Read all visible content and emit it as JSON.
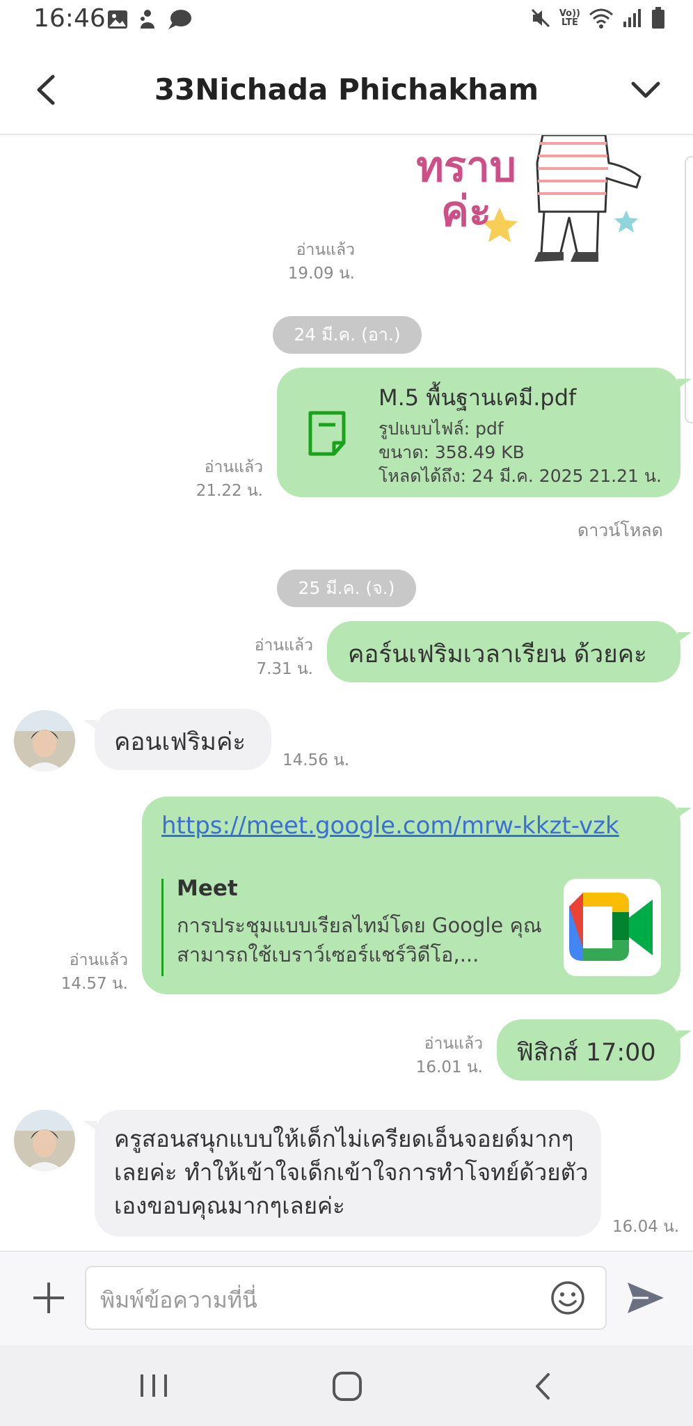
{
  "status_bar": {
    "time": "16:46",
    "left_icons": [
      "image-icon",
      "gesture-icon",
      "chat-bubble-icon"
    ],
    "volte_label": "Vo))\nLTE",
    "right_icons": [
      "mute-icon",
      "volte-icon",
      "wifi-icon",
      "signal-icon",
      "battery-icon"
    ]
  },
  "header": {
    "title": "33Nichada Phichakham"
  },
  "chat": {
    "sticker_read": {
      "status": "อ่านแล้ว",
      "time": "19.09 น."
    },
    "sticker_text": "ทราบ\nค่ะ",
    "date_1": "24 มี.ค. (อา.)",
    "file": {
      "name": "M.5 พื้นฐานเคมี.pdf",
      "type_line": "รูปแบบไฟล์: pdf",
      "size_line": "ขนาด: 358.49 KB",
      "expiry_line": "โหลดได้ถึง: 24 มี.ค. 2025 21.21 น.",
      "read": "อ่านแล้ว",
      "time": "21.22 น.",
      "download_label": "ดาวน์โหลด"
    },
    "date_2": "25 มี.ค. (จ.)",
    "msg_out_1": {
      "text": "คอร์นเฟริมเวลาเรียน ด้วยคะ",
      "read": "อ่านแล้ว",
      "time": "7.31 น."
    },
    "msg_in_1": {
      "text": "คอนเฟริมค่ะ",
      "time": "14.56 น."
    },
    "link_msg": {
      "url": "https://meet.google.com/mrw-kkzt-vzk",
      "preview_title": "Meet",
      "preview_desc": "การประชุมแบบเรียลไทม์โดย Google คุณสามารถใช้เบราว์เซอร์แชร์วิดีโอ,...",
      "read": "อ่านแล้ว",
      "time": "14.57 น."
    },
    "msg_out_2": {
      "text": "ฟิสิกส์ 17:00",
      "read": "อ่านแล้ว",
      "time": "16.01 น."
    },
    "msg_in_2": {
      "text": "ครูสอนสนุกแบบให้เด็กไม่เครียดเอ็นจอยด์มากๆเลยค่ะ ทำให้เข้าใจเด็กเข้าใจการทำโจทย์ด้วยตัวเองขอบคุณมากๆเลยค่ะ",
      "time": "16.04 น."
    }
  },
  "input": {
    "placeholder": "พิมพ์ข้อความที่นี่"
  },
  "colors": {
    "outgoing_bubble": "#b6e7b3",
    "incoming_bubble": "#f1f1f4",
    "link": "#3b6fd4",
    "file_icon": "#1aa21a"
  }
}
